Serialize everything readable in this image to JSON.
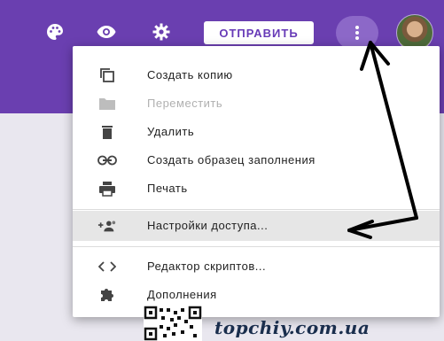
{
  "toolbar": {
    "icons": [
      "palette-icon",
      "eye-icon",
      "gear-icon",
      "more-vert-icon"
    ],
    "send_label": "ОТПРАВИТЬ"
  },
  "menu": {
    "items": [
      {
        "icon": "copy-icon",
        "label": "Создать копию",
        "enabled": true
      },
      {
        "icon": "folder-icon",
        "label": "Переместить",
        "enabled": false
      },
      {
        "icon": "trash-icon",
        "label": "Удалить",
        "enabled": true
      },
      {
        "icon": "link-icon",
        "label": "Создать образец заполнения",
        "enabled": true
      },
      {
        "icon": "printer-icon",
        "label": "Печать",
        "enabled": true
      },
      {
        "icon": "person-add-icon",
        "label": "Настройки доступа...",
        "enabled": true,
        "highlighted": true
      },
      {
        "icon": "code-icon",
        "label": "Редактор скриптов...",
        "enabled": true
      },
      {
        "icon": "puzzle-icon",
        "label": "Дополнения",
        "enabled": true
      }
    ]
  },
  "watermark": {
    "text": "topchiy.com.ua"
  },
  "colors": {
    "accent": "#6a3fb0",
    "highlight": "#e6e6e6",
    "disabled_text": "#b0b0b0"
  }
}
